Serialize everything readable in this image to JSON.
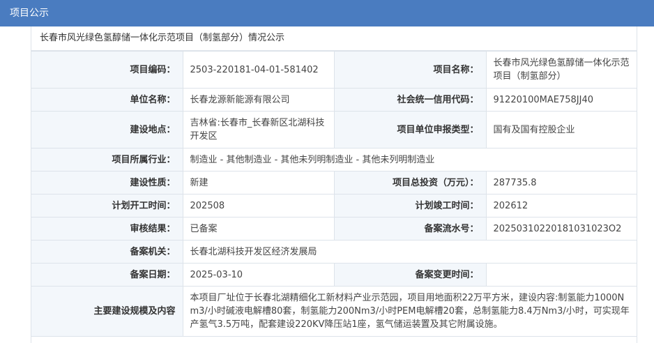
{
  "header": {
    "title": "项目公示"
  },
  "caption": "长春市风光绿色氢醇储一体化示范项目（制氢部分）情况公示",
  "fields": {
    "project_code": {
      "label": "项目编码：",
      "value": "2503-220181-04-01-581402"
    },
    "project_name": {
      "label": "项目名称：",
      "value": "长春市风光绿色氢醇储一体化示范项目（制氢部分）"
    },
    "unit_name": {
      "label": "单位名称：",
      "value": "长春龙源新能源有限公司"
    },
    "credit_code": {
      "label": "社会统一信用代码：",
      "value": "91220100MAE758JJ40"
    },
    "location": {
      "label": "建设地点：",
      "value": "吉林省:长春市_长春新区北湖科技开发区"
    },
    "unit_type": {
      "label": "项目单位申报类型：",
      "value": "国有及国有控股企业"
    },
    "industry": {
      "label": "项目所属行业：",
      "value": "制造业 - 其他制造业 - 其他未列明制造业 - 其他未列明制造业"
    },
    "nature": {
      "label": "建设性质：",
      "value": "新建"
    },
    "investment": {
      "label": "项目总投资（万元）：",
      "value": "287735.8"
    },
    "plan_start": {
      "label": "计划开工时间：",
      "value": "202508"
    },
    "plan_finish": {
      "label": "计划竣工时间：",
      "value": "202612"
    },
    "review_result": {
      "label": "审核结果：",
      "value": "已备案"
    },
    "record_serial": {
      "label": "备案流水号：",
      "value": "20250310220181031023O2"
    },
    "authority": {
      "label": "备案机关：",
      "value": "长春北湖科技开发区经济发展局"
    },
    "record_date": {
      "label": "备案日期：",
      "value": "2025-03-10"
    },
    "change_time": {
      "label": "备案变更时间：",
      "value": ""
    },
    "scale_content": {
      "label": "主要建设规模及内容",
      "value": "本项目厂址位于长春北湖精细化工新材料产业示范园，项目用地面积22万平方米，建设内容:制氢能力1000Nm3/小时碱液电解槽80套，制氢能力200Nm3/小时PEM电解槽20套，总制氢能力8.4万Nm3/小时，可实现年产氢气3.5万吨，配套建设220KV降压站1座，氢气储运装置及其它附属设施。"
    }
  }
}
